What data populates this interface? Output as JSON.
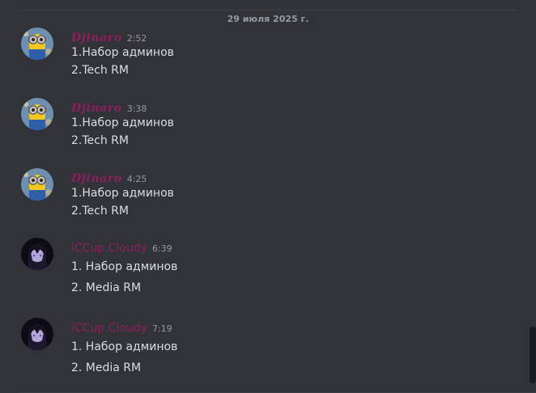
{
  "date_divider": "29 июля 2025 г.",
  "messages": [
    {
      "author": "Djinaro",
      "author_style": "script",
      "time": "2:52",
      "lines": [
        "1.Набор админов",
        "2.Tech RM"
      ],
      "avatar": "minion-avatar"
    },
    {
      "author": "Djinaro",
      "author_style": "script",
      "time": "3:38",
      "lines": [
        "1.Набор админов",
        "2.Tech RM"
      ],
      "avatar": "minion-avatar"
    },
    {
      "author": "Djinaro",
      "author_style": "script",
      "time": "4:25",
      "lines": [
        "1.Набор админов",
        "2.Tech RM"
      ],
      "avatar": "minion-avatar"
    },
    {
      "author": "iCCup.Cloudy",
      "author_style": "plain",
      "time": "6:39",
      "lines": [
        "1. Набор админов",
        "2. Media RM"
      ],
      "avatar": "dark-anime-avatar"
    },
    {
      "author": "iCCup.Cloudy",
      "author_style": "plain",
      "time": "7:19",
      "lines": [
        "1. Набор админов",
        "2. Media RM"
      ],
      "avatar": "dark-anime-avatar"
    }
  ],
  "colors": {
    "background": "#313338",
    "author": "#8e1f5e",
    "text": "#dbdee1",
    "muted": "#949ba4"
  }
}
